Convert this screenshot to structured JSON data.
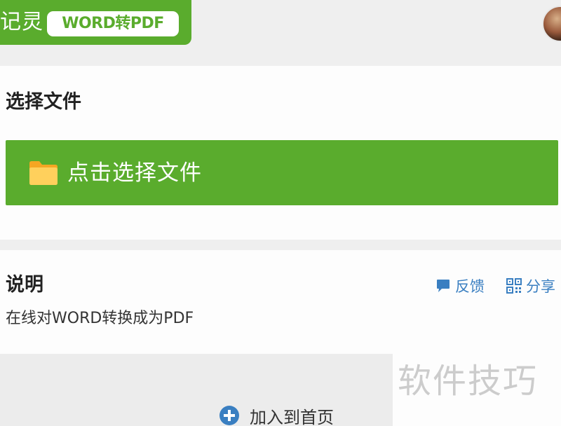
{
  "header": {
    "logo_text": "记灵",
    "tool_badge": "WORD转PDF",
    "avatar_icon": "user-avatar"
  },
  "select_section": {
    "title": "选择文件",
    "button_label": "点击选择文件",
    "button_icon": "folder-icon",
    "button_color": "#5aac2d"
  },
  "description_section": {
    "title": "说明",
    "text": "在线对WORD转换成为PDF",
    "feedback_label": "反馈",
    "feedback_icon": "chat-bubble-icon",
    "share_label": "分享",
    "share_icon": "qr-code-icon",
    "link_color": "#3a7fc1"
  },
  "footer": {
    "add_home_label": "加入到首页",
    "add_home_icon": "plus-circle-icon"
  },
  "watermark": "软件技巧"
}
